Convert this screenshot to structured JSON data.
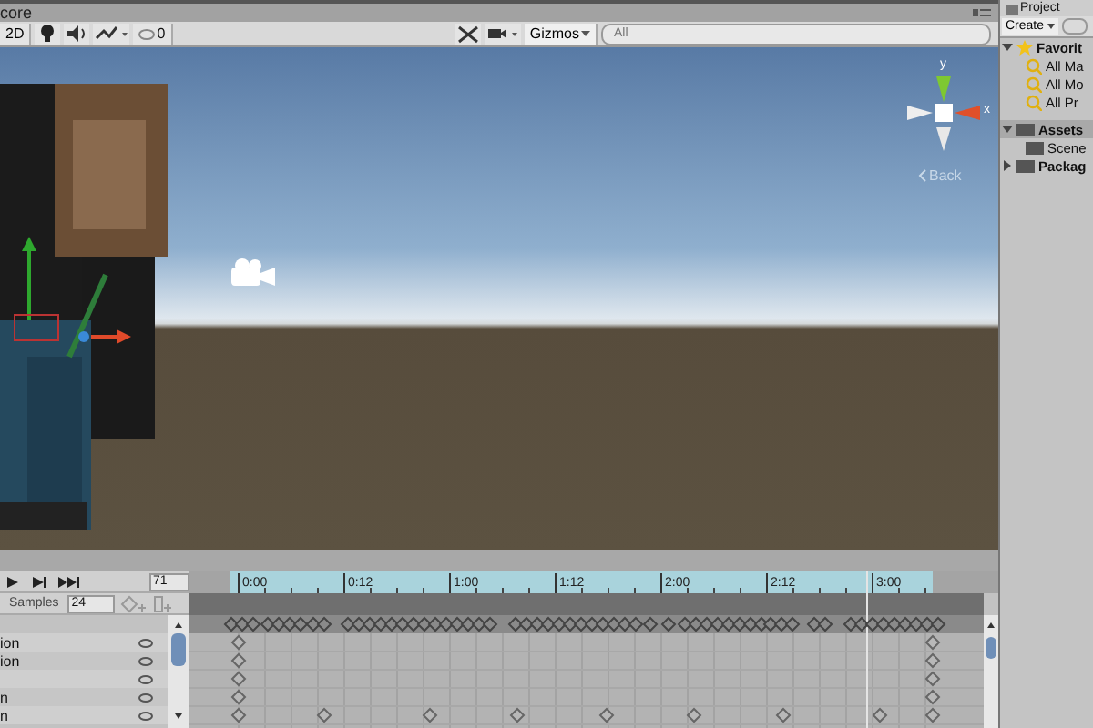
{
  "scene_tab": {
    "title": "core"
  },
  "scene_toolbar": {
    "mode_button": "2D",
    "hidden_count": "0",
    "gizmos_button": "Gizmos",
    "search": {
      "placeholder": "All"
    }
  },
  "scene_gizmo": {
    "y_label": "y",
    "x_label": "x",
    "view_label": "Back"
  },
  "animation": {
    "frame": "71",
    "samples_label": "Samples",
    "samples": "24",
    "ruler": [
      "0:00",
      "0:12",
      "1:00",
      "1:12",
      "2:00",
      "2:12",
      "3:00"
    ],
    "properties": [
      {
        "kind": "named",
        "name": "ion"
      },
      {
        "kind": "named",
        "name": "ion"
      },
      {
        "kind": "blank"
      },
      {
        "kind": "named",
        "name": "n"
      },
      {
        "kind": "named",
        "name": "n"
      }
    ]
  },
  "project": {
    "tab": "Project",
    "create_button": "Create",
    "tree": [
      {
        "label": "Favorit",
        "kind": "star",
        "expanded": true,
        "selected": false,
        "children": [
          {
            "label": "All Ma",
            "kind": "search",
            "selected": false
          },
          {
            "label": "All Mo",
            "kind": "search",
            "selected": false
          },
          {
            "label": "All Pr",
            "kind": "search",
            "selected": false
          }
        ]
      },
      {
        "label": "Assets",
        "kind": "folder",
        "expanded": true,
        "selected": true,
        "children": [
          {
            "label": "Scene",
            "kind": "folder",
            "selected": false
          }
        ]
      },
      {
        "label": "Packag",
        "kind": "folder",
        "expanded": false,
        "selected": false
      }
    ]
  }
}
